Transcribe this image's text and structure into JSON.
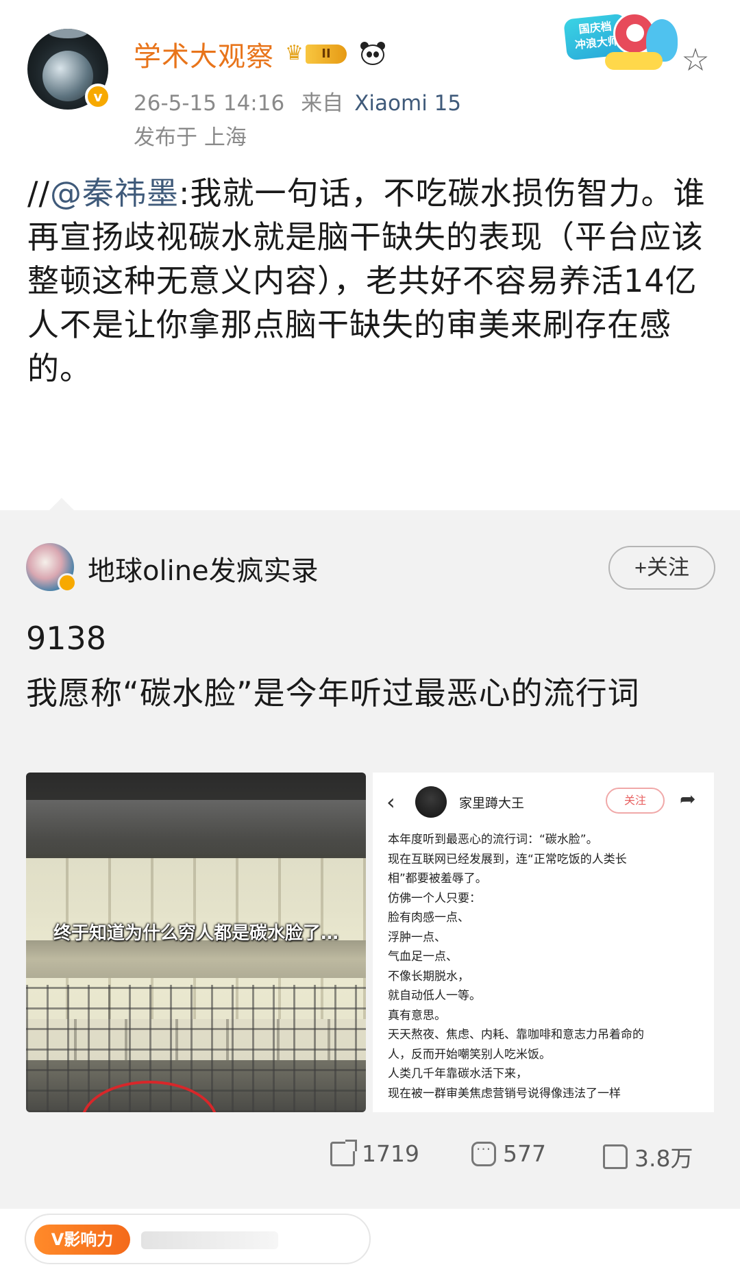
{
  "post": {
    "username": "学术大观察",
    "rank_label": "II",
    "timestamp": "26-5-15 14:16",
    "source_label": "来自",
    "source_device": "Xiaomi 15",
    "location": "发布于 上海",
    "event_badge_text": "国庆档\n冲浪大师",
    "body_prefix": "//",
    "mention": "@秦祎墨",
    "body_text": ":我就一句话，不吃碳水损伤智力。谁再宣扬歧视碳水就是脑干缺失的表现（平台应该整顿这种无意义内容），老共好不容易养活14亿人不是让你拿那点脑干缺失的审美来刷存在感的。"
  },
  "retweet": {
    "username": "地球oline发疯实录",
    "follow_label": "+关注",
    "count": "9138",
    "text": "我愿称“碳水脸”是今年听过最恶心的流行词",
    "image_left_caption": "终于知道为什么穷人都是碳水脸了…",
    "image_right": {
      "name": "家里蹲大王",
      "follow": "关注",
      "lines": [
        "本年度听到最恶心的流行词：“碳水脸”。",
        "现在互联网已经发展到，连“正常吃饭的人类长",
        "相”都要被羞辱了。",
        "仿佛一个人只要：",
        "脸有肉感一点、",
        "浮肿一点、",
        "气血足一点、",
        "不像长期脱水，",
        "就自动低人一等。",
        "真有意思。",
        "天天熬夜、焦虑、内耗、靠咖啡和意志力吊着命的",
        "人，反而开始嘲笑别人吃米饭。",
        "人类几千年靠碳水活下来，",
        "现在被一群审美焦虑营销号说得像违法了一样"
      ]
    },
    "actions": {
      "repost": "1719",
      "comment": "577",
      "like": "3.8万"
    }
  },
  "influence": {
    "label": "V影响力"
  },
  "colors": {
    "username": "#e8741a",
    "link": "#3f5a7a",
    "meta": "#8a8a8a",
    "retweet_bg": "#f2f2f2",
    "influence": "#f46a1a"
  }
}
